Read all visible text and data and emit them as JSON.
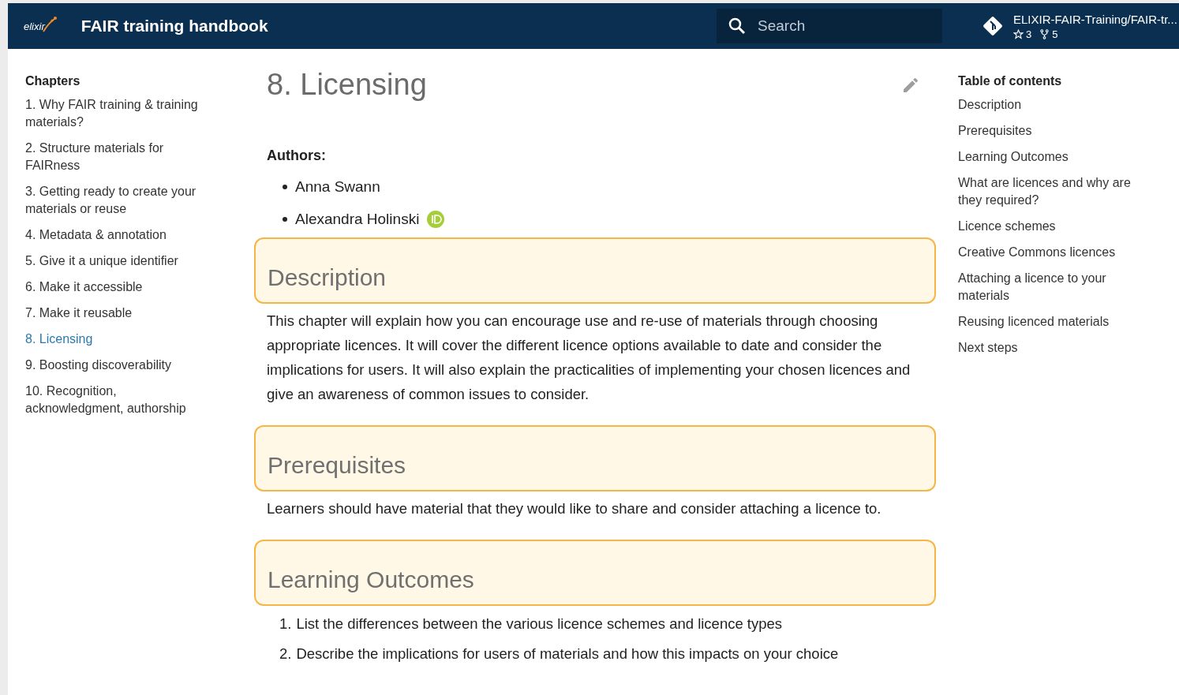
{
  "header": {
    "logo_text": "elixir",
    "title": "FAIR training handbook",
    "search": {
      "placeholder": "Search"
    },
    "repo": {
      "name": "ELIXIR-FAIR-Training/FAIR-tr...",
      "stars": "3",
      "forks": "5"
    }
  },
  "chapters": {
    "title": "Chapters",
    "items": [
      {
        "label": "1. Why FAIR training & training materials?",
        "selected": false
      },
      {
        "label": "2. Structure materials for FAIRness",
        "selected": false
      },
      {
        "label": "3. Getting ready to create your materials or reuse",
        "selected": false
      },
      {
        "label": "4. Metadata & annotation",
        "selected": false
      },
      {
        "label": "5. Give it a unique identifier",
        "selected": false
      },
      {
        "label": "6. Make it accessible",
        "selected": false
      },
      {
        "label": "7. Make it reusable",
        "selected": false
      },
      {
        "label": "8. Licensing",
        "selected": true
      },
      {
        "label": "9. Boosting discoverability",
        "selected": false
      },
      {
        "label": "10. Recognition, acknowledgment, authorship",
        "selected": false
      }
    ]
  },
  "content": {
    "title": "8. Licensing",
    "authors_label": "Authors:",
    "authors": [
      {
        "name": "Anna Swann",
        "orcid": false
      },
      {
        "name": "Alexandra Holinski",
        "orcid": true
      }
    ],
    "sections": [
      {
        "heading": "Description",
        "kind": "paragraph",
        "text": "This chapter will explain how you can encourage use and re-use of materials through choosing appropriate licences. It will cover the different licence options available to date and consider the implications for users. It will also explain the practicalities of implementing your chosen licences and give an awareness of common issues to consider."
      },
      {
        "heading": "Prerequisites",
        "kind": "paragraph",
        "text": "Learners should have material that they would like to share and consider attaching a licence to."
      },
      {
        "heading": "Learning Outcomes",
        "kind": "list",
        "items": [
          {
            "number": "1.",
            "text": "List the differences between the various licence schemes and licence types"
          },
          {
            "number": "2.",
            "text": "Describe the implications for users of materials and how this impacts on your choice"
          }
        ]
      }
    ]
  },
  "toc": {
    "title": "Table of contents",
    "items": [
      "Description",
      "Prerequisites",
      "Learning Outcomes",
      "What are licences and why are they required?",
      "Licence schemes",
      "Creative Commons licences",
      "Attaching a licence to your materials",
      "Reusing licenced materials",
      "Next steps"
    ]
  }
}
